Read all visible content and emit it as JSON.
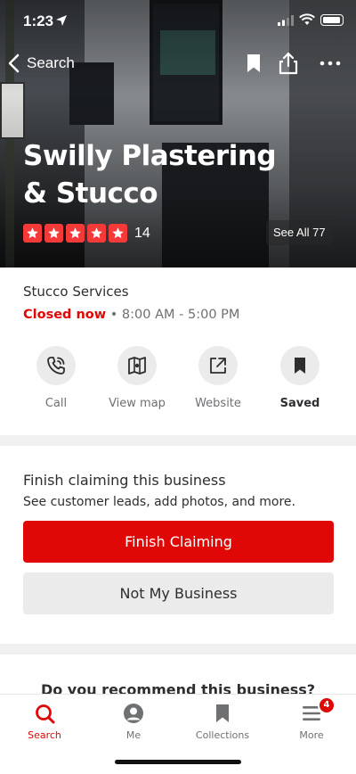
{
  "status_bar": {
    "time": "1:23"
  },
  "nav": {
    "back_label": "Search"
  },
  "business": {
    "name": "Swilly Plastering & Stucco",
    "rating_stars": 5,
    "review_count": "14",
    "see_all_label": "See All 77",
    "category": "Stucco Services",
    "status": "Closed now",
    "hours": "• 8:00 AM - 5:00 PM"
  },
  "actions": [
    {
      "label": "Call",
      "icon": "phone-icon"
    },
    {
      "label": "View map",
      "icon": "map-icon"
    },
    {
      "label": "Website",
      "icon": "external-link-icon"
    },
    {
      "label": "Saved",
      "icon": "bookmark-icon"
    }
  ],
  "claim": {
    "title": "Finish claiming this business",
    "subtitle": "See customer leads, add photos, and more.",
    "primary_button": "Finish Claiming",
    "secondary_button": "Not My Business"
  },
  "recommend_prompt": "Do you recommend this business?",
  "tabbar": {
    "tabs": [
      {
        "label": "Search",
        "icon": "search-icon",
        "active": true
      },
      {
        "label": "Me",
        "icon": "profile-icon",
        "active": false
      },
      {
        "label": "Collections",
        "icon": "bookmark-icon",
        "active": false
      },
      {
        "label": "More",
        "icon": "menu-icon",
        "active": false,
        "badge": "4"
      }
    ]
  },
  "colors": {
    "brand_red": "#e00707",
    "star_red": "#f43939"
  }
}
